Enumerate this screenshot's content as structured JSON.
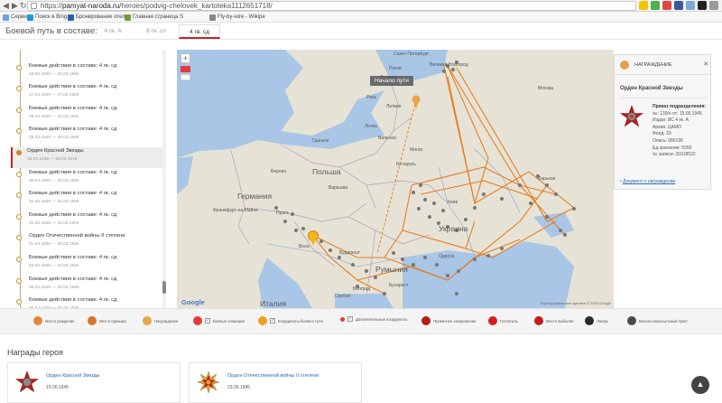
{
  "browser": {
    "url_prefix": "https://",
    "url_host": "pamyat-naroda.ru",
    "url_path": "/heroes/podvig-chelovek_kartoteka1112651718/",
    "bookmarks": [
      "Сервисы",
      "Поиск в Bing",
      "Бронирование отел",
      "Главная страница S",
      "Fly-by-wire - Wikipe"
    ]
  },
  "header": {
    "title": "Боевой путь в составе:",
    "tabs": [
      {
        "label": "4 гв. А",
        "active": false
      },
      {
        "label": "8 гв. сп",
        "active": false
      },
      {
        "label": "4 гв. сд",
        "active": true
      }
    ]
  },
  "timeline": [
    {
      "title": "",
      "date": "",
      "selected": false
    },
    {
      "title": "Боевые действия в составе: 4 гв. сд",
      "date": "23.03.1945 — 31.03.1945",
      "selected": false
    },
    {
      "title": "Боевые действия в составе: 4 гв. сд",
      "date": "27.03.1945 — 27.03.1945",
      "selected": false
    },
    {
      "title": "Боевые действия в составе: 4 гв. сд",
      "date": "28.03.1945 — 31.03.1945",
      "selected": false
    },
    {
      "title": "Боевые действия в составе: 4 гв. сд",
      "date": "28.03.1945 — 28.03.1945",
      "selected": false
    },
    {
      "title": "Орден Красной Звезды",
      "date": "28.03.1945 — 28.03.1945",
      "selected": true
    },
    {
      "title": "Боевые действия в составе: 4 гв. сд",
      "date": "30.03.1945 — 30.03.1945",
      "selected": false
    },
    {
      "title": "Боевые действия в составе: 4 гв. сд",
      "date": "31.03.1945 — 31.03.1945",
      "selected": false
    },
    {
      "title": "Боевые действия в составе: 4 гв. сд",
      "date": "31.03.1945 — 31.03.1945",
      "selected": false
    },
    {
      "title": "Орден Отечественной войны II степени",
      "date": "01.04.1945 — 30.04.1945",
      "selected": false
    },
    {
      "title": "Боевые действия в составе: 4 гв. сд",
      "date": "03.04.1945 — 03.04.1945",
      "selected": false
    },
    {
      "title": "Боевые действия в составе: 4 гв. сд",
      "date": "05.04.1945 — 05.04.1945",
      "selected": false
    },
    {
      "title": "Боевые действия в составе: 4 гв. сд",
      "date": "05.04.1945 — 05.04.1945",
      "selected": false
    }
  ],
  "map": {
    "tooltip": "Начало пути",
    "countries": [
      "Германия",
      "Польша",
      "Украина",
      "Румыния",
      "Италия",
      "Беларусь",
      "Литва",
      "Латвия",
      "Эстония"
    ],
    "cities": [
      "Санкт-Петербург",
      "Великий Новгород",
      "Псков",
      "Рига",
      "Вильнюс",
      "Минск",
      "Гданьск",
      "Варшава",
      "Берлин",
      "Прага",
      "Вена",
      "Будапешт",
      "Киев",
      "Одесса",
      "Бухарест",
      "Белград",
      "Харьков",
      "Москва",
      "Сербия",
      "Франкфурт-на-Майне"
    ],
    "google_label": "Google",
    "copyright": "Картографические данные © 2015 Google"
  },
  "award_panel": {
    "header": "НАГРАЖДЕНИЕ",
    "name": "Орден Красной Звезды",
    "details": [
      {
        "label": "Приказ подразделения:",
        "bold": true
      },
      {
        "label": "№: 139/н от: 15.06.1945",
        "bold": false
      },
      {
        "label": "Издан: ВС 4 гв. А",
        "bold": false
      },
      {
        "label": "Архив: ЦАМО",
        "bold": false
      },
      {
        "label": "Фонд: 33",
        "bold": false
      },
      {
        "label": "Опись: 686196",
        "bold": false
      },
      {
        "label": "Ед.хранения: 5050",
        "bold": false
      },
      {
        "label": "№ записи: 26918522",
        "bold": false
      }
    ],
    "doc_link": "Документ о награждении"
  },
  "legend": [
    {
      "label": "Место рождения",
      "color": "#e8843a",
      "type": "icon"
    },
    {
      "label": "Место призыва",
      "color": "#d8742a",
      "type": "icon"
    },
    {
      "label": "Награждение",
      "color": "#e3a94a",
      "type": "icon"
    },
    {
      "label": "Боевые операции",
      "color": "#e23b3b",
      "type": "check"
    },
    {
      "label": "Координаты боевого пути",
      "color": "#f29c1f",
      "type": "check"
    },
    {
      "label": "Дополнительные координаты",
      "color": "#e23b3b",
      "type": "check-dot"
    },
    {
      "label": "Первичное захоронение",
      "color": "#b51c1c",
      "type": "icon"
    },
    {
      "label": "Госпиталь",
      "color": "#d22020",
      "type": "icon"
    },
    {
      "label": "Место выбытия",
      "color": "#c41c1c",
      "type": "icon"
    },
    {
      "label": "Лагерь",
      "color": "#2a2a2a",
      "type": "icon"
    },
    {
      "label": "Военно-пересыльный пункт",
      "color": "#4a4a4a",
      "type": "icon"
    }
  ],
  "hero_awards": {
    "title": "Награды героя",
    "items": [
      {
        "name": "Орден Красной Звезды",
        "date": "15.06.1945"
      },
      {
        "name": "Орден Отечественной войны II степени",
        "date": "23.06.1945"
      }
    ]
  },
  "colors": {
    "accent": "#cc2222",
    "route": "#e67e22",
    "link": "#2a6ab4"
  }
}
